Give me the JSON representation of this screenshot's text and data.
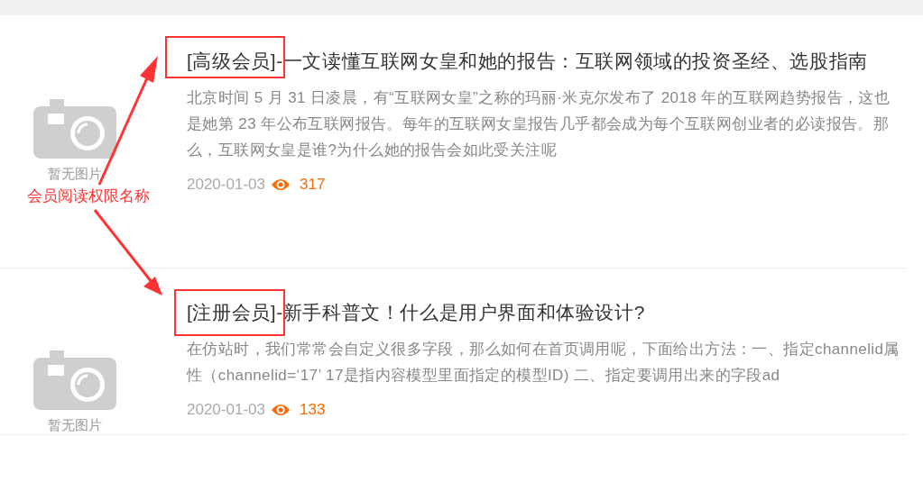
{
  "articles": [
    {
      "title": "[高级会员]-一文读懂互联网女皇和她的报告：互联网领域的投资圣经、选股指南",
      "thumbnail_caption": "暂无图片",
      "summary": "北京时间 5 月 31 日凌晨，有“互联网女皇”之称的玛丽·米克尔发布了 2018 年的互联网趋势报告，这也是她第 23 年公布互联网报告。每年的互联网女皇报告几乎都会成为每个互联网创业者的必读报告。那么，互联网女皇是谁?为什么她的报告会如此受关注呢",
      "date": "2020-01-03",
      "views": "317"
    },
    {
      "title": "[注册会员]-新手科普文！什么是用户界面和体验设计?",
      "thumbnail_caption": "暂无图片",
      "summary": "在仿站时，我们常常会自定义很多字段，那么如何在首页调用呢，下面给出方法：一、指定channelid属性（channelid=‘17’ 17是指内容模型里面指定的模型ID) 二、指定要调用出来的字段ad",
      "date": "2020-01-03",
      "views": "133"
    }
  ],
  "annotation": {
    "label": "会员阅读权限名称"
  }
}
